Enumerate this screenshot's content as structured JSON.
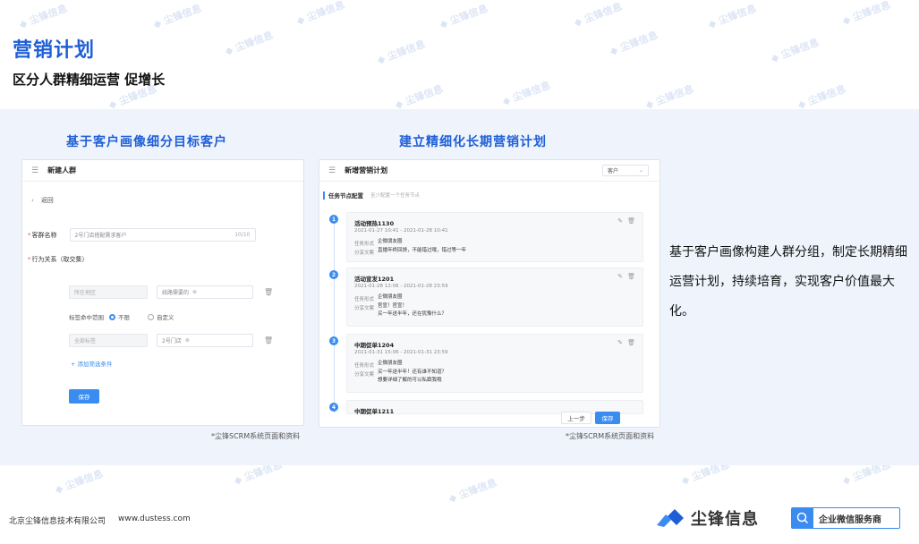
{
  "page": {
    "title": "营销计划",
    "subtitle": "区分人群精细运营 促增长"
  },
  "watermark": "尘锋信息",
  "left_section": {
    "heading": "基于客户画像细分目标客户",
    "window_title": "新建人群",
    "back_label": "返回",
    "group_name_label": "客群名称",
    "group_name_value": "2号门店搭配需求客户",
    "group_name_count": "10/10",
    "behavior_label": "行为关系（取交集）",
    "filter1_field": "所在地区",
    "filter1_value": "线路需要的",
    "tag_scope_label": "标签命中范围",
    "radio_unlimited": "不限",
    "radio_custom": "自定义",
    "filter2_field": "全部标签",
    "filter2_value": "2号门店",
    "add_filter_label": "+ 添加筛选条件",
    "save_button": "保存",
    "caption": "*尘锋SCRM系统页面和资料"
  },
  "right_section": {
    "heading": "建立精细化长期营销计划",
    "window_title": "新增营销计划",
    "top_select": "客户",
    "tab_label": "任务节点配置",
    "tab_hint": "至少配置一个任务节点",
    "field_form_label": "任务形式",
    "field_copy_label": "分享文案",
    "tasks": [
      {
        "index": "1",
        "name": "活动预热1130",
        "time": "2021-01-27 10:41 - 2021-01-28 10:41",
        "form": "企微朋友圈",
        "copy": [
          "直播年终回馈，不能错过哦，错过等一年"
        ]
      },
      {
        "index": "2",
        "name": "活动宣发1201",
        "time": "2021-01-28 12:06 - 2021-01-28 23:59",
        "form": "企微朋友圈",
        "copy": [
          "官宣！官宣！",
          "买一年送半年，还在犹豫什么？"
        ]
      },
      {
        "index": "3",
        "name": "中期促单1204",
        "time": "2021-01-31 15:06 - 2021-01-31 23:59",
        "form": "企微朋友圈",
        "copy": [
          "买一年送半年！还有谁不知道？",
          "想要详细了解的可以私戳我哦"
        ]
      },
      {
        "index": "4",
        "name": "中期促单1211",
        "time": "",
        "form": "",
        "copy": []
      }
    ],
    "prev_button": "上一步",
    "next_button": "保存",
    "caption": "*尘锋SCRM系统页面和资料"
  },
  "description": "基于客户画像构建人群分组，制定长期精细运营计划，持续培育，实现客户价值最大化。",
  "footer": {
    "company": "北京尘锋信息技术有限公司",
    "url": "www.dustess.com",
    "brand": "尘锋信息",
    "badge": "企业微信服务商"
  },
  "colors": {
    "accent": "#1f5fd6",
    "button": "#3b8cf0",
    "band": "#eef3fc"
  }
}
